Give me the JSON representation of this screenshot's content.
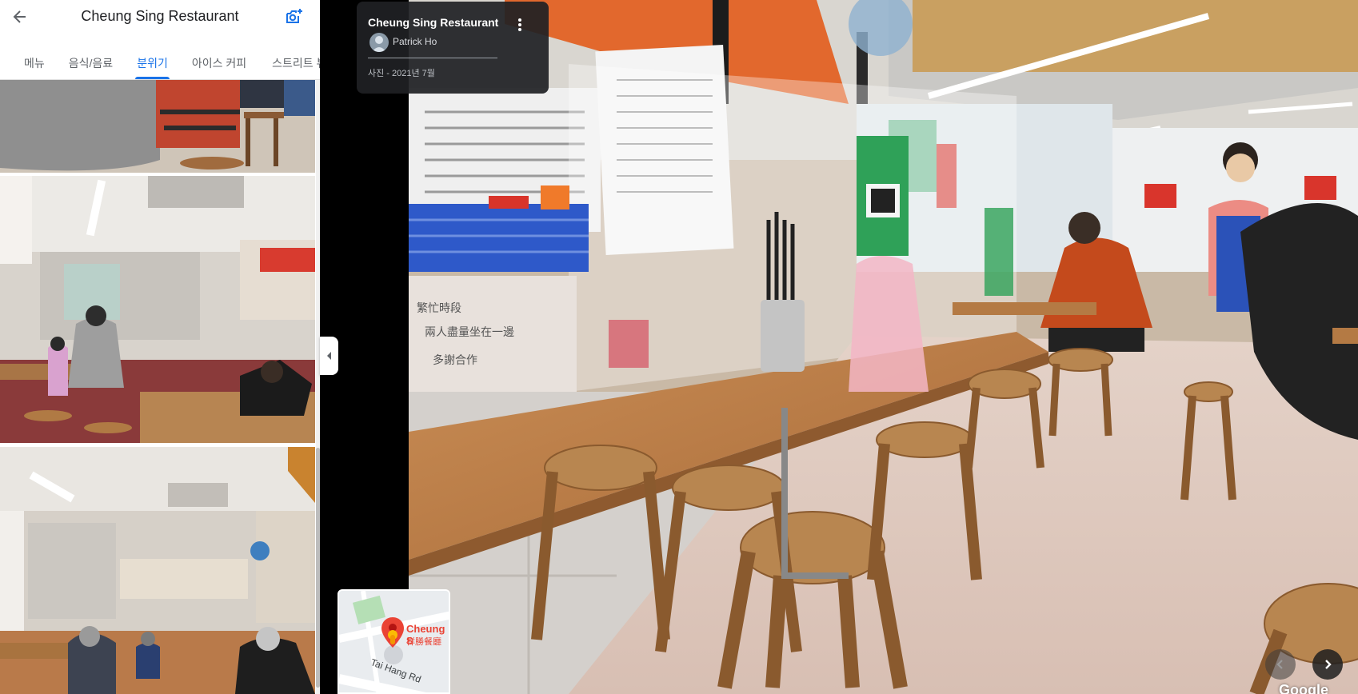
{
  "header": {
    "title": "Cheung Sing Restaurant",
    "back_icon": "arrow-left-icon",
    "add_photo_icon": "add-photo-icon"
  },
  "tabs": [
    {
      "label": "메뉴",
      "active": false
    },
    {
      "label": "음식/음료",
      "active": false
    },
    {
      "label": "분위기",
      "active": true
    },
    {
      "label": "아이스 커피",
      "active": false
    },
    {
      "label": "스트리트 뷰",
      "active": false
    }
  ],
  "info_card": {
    "title": "Cheung Sing Restaurant",
    "author": "Patrick Ho",
    "date": "사진 - 2021년 7월"
  },
  "minimap": {
    "place_label_en": "Cheung S",
    "place_label_zh": "祥勝餐廳",
    "road_label": "Tai Hang Rd"
  },
  "watermark": "Google",
  "colors": {
    "accent": "#1a73e8",
    "pin": "#ea4335"
  }
}
